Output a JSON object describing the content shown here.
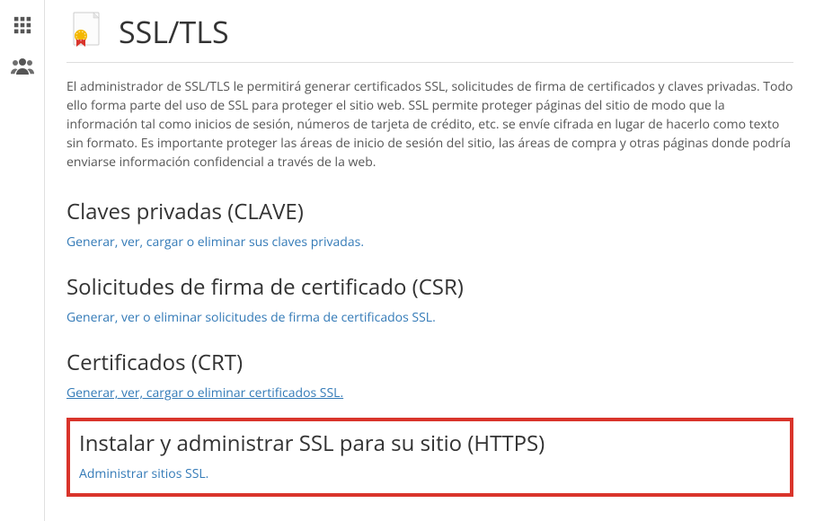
{
  "sidebar": {
    "items": [
      {
        "name": "apps"
      },
      {
        "name": "users"
      }
    ]
  },
  "header": {
    "title": "SSL/TLS"
  },
  "description": "El administrador de SSL/TLS le permitirá generar certificados SSL, solicitudes de firma de certificados y claves privadas. Todo ello forma parte del uso de SSL para proteger el sitio web. SSL permite proteger páginas del sitio de modo que la información tal como inicios de sesión, números de tarjeta de crédito, etc. se envíe cifrada en lugar de hacerlo como texto sin formato. Es importante proteger las áreas de inicio de sesión del sitio, las áreas de compra y otras páginas donde podría enviarse información confidencial a través de la web.",
  "sections": {
    "private_keys": {
      "title": "Claves privadas (CLAVE)",
      "link": "Generar, ver, cargar o eliminar sus claves privadas."
    },
    "csr": {
      "title": "Solicitudes de firma de certificado (CSR)",
      "link": "Generar, ver o eliminar solicitudes de firma de certificados SSL."
    },
    "crt": {
      "title": "Certificados (CRT)",
      "link": "Generar, ver, cargar o eliminar certificados SSL."
    },
    "install": {
      "title": "Instalar y administrar SSL para su sitio (HTTPS)",
      "link": "Administrar sitios SSL."
    }
  }
}
